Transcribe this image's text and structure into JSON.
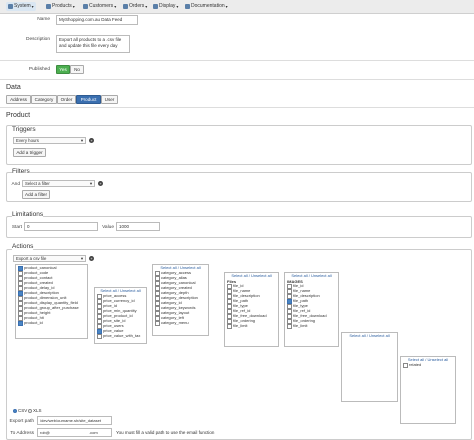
{
  "nav": {
    "items": [
      {
        "label": "System",
        "icon": "gear-icon"
      },
      {
        "label": "Products",
        "icon": "box-icon"
      },
      {
        "label": "Customers",
        "icon": "users-icon"
      },
      {
        "label": "Orders",
        "icon": "cart-icon"
      },
      {
        "label": "Display",
        "icon": "display-icon"
      },
      {
        "label": "Documentation",
        "icon": "book-icon"
      }
    ]
  },
  "form": {
    "name_label": "Name",
    "name_value": "MyShopping.com.au Data Feed",
    "description_label": "Description",
    "description_value": "Export all products to a .csv file and update this file every day",
    "published_label": "Published",
    "published_yes": "Yes",
    "published_no": "No"
  },
  "data_section": {
    "title": "Data",
    "tabs": [
      "Address",
      "Category",
      "Order",
      "Product",
      "User"
    ],
    "active_tab": "Product"
  },
  "product": {
    "title": "Product",
    "triggers": {
      "title": "Triggers",
      "select_value": "Every hours",
      "add_button": "Add a trigger"
    },
    "filters": {
      "title": "Filters",
      "and_label": "And",
      "select_placeholder": "Select a filter",
      "add_button": "Add a filter"
    },
    "limitations": {
      "title": "Limitations",
      "start_label": "Start",
      "start_value": "0",
      "value_label": "Value",
      "value_value": "1000"
    },
    "actions": {
      "title": "Actions",
      "select_value": "Export a csv file",
      "select_all_label": "Select all / Unselect all",
      "product_columns": [
        {
          "label": "product_canonical",
          "checked": true
        },
        {
          "label": "product_code",
          "checked": false
        },
        {
          "label": "product_contact",
          "checked": false
        },
        {
          "label": "product_created",
          "checked": false
        },
        {
          "label": "product_delay_id",
          "checked": false
        },
        {
          "label": "product_description",
          "checked": true
        },
        {
          "label": "product_dimension_unit",
          "checked": false
        },
        {
          "label": "product_display_quantity_field",
          "checked": false
        },
        {
          "label": "product_group_after_purchase",
          "checked": false
        },
        {
          "label": "product_height",
          "checked": false
        },
        {
          "label": "product_hit",
          "checked": false
        },
        {
          "label": "product_id",
          "checked": true
        }
      ],
      "price_columns": [
        {
          "label": "price_access",
          "checked": false
        },
        {
          "label": "price_currency_id",
          "checked": false
        },
        {
          "label": "price_id",
          "checked": false
        },
        {
          "label": "price_min_quantity",
          "checked": false
        },
        {
          "label": "price_product_id",
          "checked": false
        },
        {
          "label": "price_site_id",
          "checked": false
        },
        {
          "label": "price_users",
          "checked": false
        },
        {
          "label": "price_value",
          "checked": true
        },
        {
          "label": "price_value_with_tax",
          "checked": false
        }
      ],
      "category_columns": [
        {
          "label": "category_access",
          "checked": false
        },
        {
          "label": "category_alias",
          "checked": false
        },
        {
          "label": "category_canonical",
          "checked": false
        },
        {
          "label": "category_created",
          "checked": false
        },
        {
          "label": "category_depth",
          "checked": false
        },
        {
          "label": "category_description",
          "checked": false
        },
        {
          "label": "category_id",
          "checked": false
        },
        {
          "label": "category_keywords",
          "checked": false
        },
        {
          "label": "category_layout",
          "checked": false
        },
        {
          "label": "category_left",
          "checked": false
        },
        {
          "label": "category_menu",
          "checked": false
        }
      ],
      "files_title": "Files",
      "files_columns": [
        {
          "label": "file_id",
          "checked": false
        },
        {
          "label": "file_name",
          "checked": false
        },
        {
          "label": "file_description",
          "checked": false
        },
        {
          "label": "file_path",
          "checked": false
        },
        {
          "label": "file_type",
          "checked": false
        },
        {
          "label": "file_ref_id",
          "checked": false
        },
        {
          "label": "file_free_download",
          "checked": false
        },
        {
          "label": "file_ordering",
          "checked": false
        },
        {
          "label": "file_limit",
          "checked": false
        }
      ],
      "images_title": "IMAGES",
      "images_columns": [
        {
          "label": "file_id",
          "checked": false
        },
        {
          "label": "file_name",
          "checked": false
        },
        {
          "label": "file_description",
          "checked": false
        },
        {
          "label": "file_path",
          "checked": true
        },
        {
          "label": "file_type",
          "checked": false
        },
        {
          "label": "file_ref_id",
          "checked": false
        },
        {
          "label": "file_free_download",
          "checked": false
        },
        {
          "label": "file_ordering",
          "checked": false
        },
        {
          "label": "file_limit",
          "checked": false
        }
      ],
      "related_columns": [
        {
          "label": "related",
          "checked": false
        }
      ],
      "format_csv": "CSV",
      "format_xls": "XLS",
      "export_path_label": "Export path",
      "export_path_value": "/dev/web/ourname.sh/site_dataset",
      "to_address_label": "To Address",
      "to_address_value": "rob@",
      "to_address_domain": ".com",
      "note": "You must fill a valid path to use the email function"
    }
  }
}
